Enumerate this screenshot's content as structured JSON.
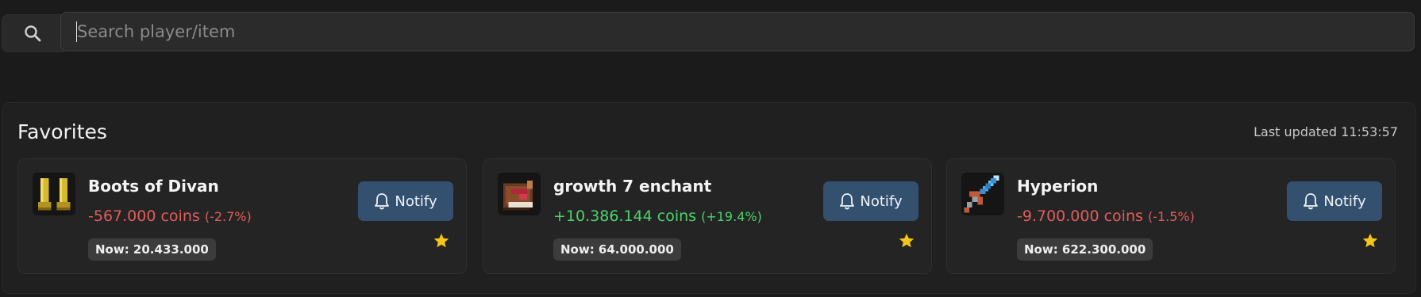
{
  "search": {
    "placeholder": "Search player/item",
    "icon": "search-icon"
  },
  "favorites": {
    "title": "Favorites",
    "last_updated": "Last updated 11:53:57",
    "cards": [
      {
        "name": "Boots of Divan",
        "delta": "-567.000 coins",
        "pct": "(-2.7%)",
        "trend": "negative",
        "now": "Now: 20.433.000",
        "notify": "Notify",
        "icon": "boots-icon"
      },
      {
        "name": "growth 7 enchant",
        "delta": "+10.386.144 coins",
        "pct": "(+19.4%)",
        "trend": "positive",
        "now": "Now: 64.000.000",
        "notify": "Notify",
        "icon": "enchanted-book-icon"
      },
      {
        "name": "Hyperion",
        "delta": "-9.700.000 coins",
        "pct": "(-1.5%)",
        "trend": "negative",
        "now": "Now: 622.300.000",
        "notify": "Notify",
        "icon": "sword-icon"
      }
    ]
  },
  "colors": {
    "negative": "#e25c5c",
    "positive": "#4cd46a",
    "notify_bg": "#34506f",
    "star": "#f5c518"
  }
}
